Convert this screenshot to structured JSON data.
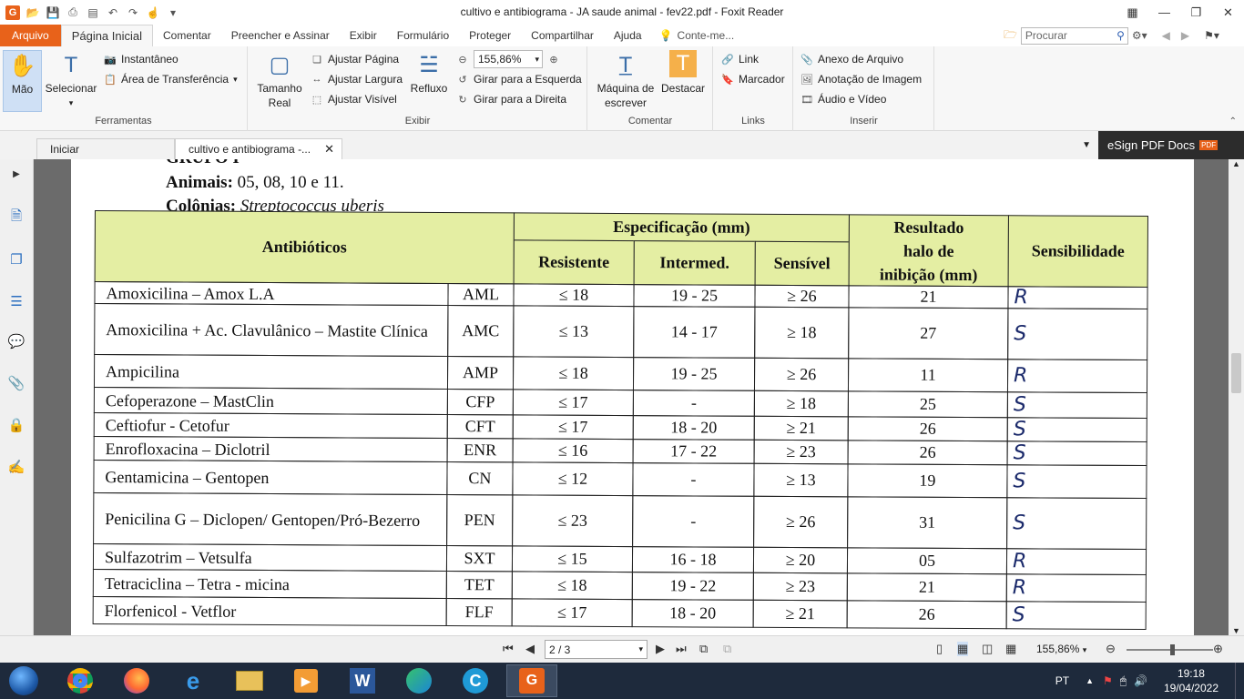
{
  "window": {
    "title": "cultivo e antibiograma - JA saude animal - fev22.pdf - Foxit Reader"
  },
  "menu": {
    "tabs": [
      "Arquivo",
      "Página Inicial",
      "Comentar",
      "Preencher e Assinar",
      "Exibir",
      "Formulário",
      "Proteger",
      "Compartilhar",
      "Ajuda"
    ],
    "tell_me": "Conte-me...",
    "search_placeholder": "Procurar"
  },
  "ribbon": {
    "ferramentas": {
      "label": "Ferramentas",
      "mao": "Mão",
      "selecionar": "Selecionar",
      "instantaneo": "Instantâneo",
      "area_transferencia": "Área de Transferência"
    },
    "exibir": {
      "label": "Exibir",
      "tamanho_real_1": "Tamanho",
      "tamanho_real_2": "Real",
      "ajustar_pagina": "Ajustar Página",
      "ajustar_largura": "Ajustar Largura",
      "ajustar_visivel": "Ajustar Visível",
      "refluxo": "Refluxo",
      "zoom": "155,86%",
      "girar_esquerda": "Girar para a Esquerda",
      "girar_direita": "Girar para a Direita"
    },
    "comentar": {
      "label": "Comentar",
      "maquina_1": "Máquina de",
      "maquina_2": "escrever",
      "destacar": "Destacar"
    },
    "links": {
      "label": "Links",
      "link": "Link",
      "marcador": "Marcador"
    },
    "inserir": {
      "label": "Inserir",
      "anexo": "Anexo de Arquivo",
      "anotacao": "Anotação de Imagem",
      "audio": "Áudio e Vídeo"
    }
  },
  "doc_tabs": [
    "Iniciar",
    "cultivo e antibiograma -..."
  ],
  "esign": "eSign PDF Docs",
  "esign_badge": "PDF",
  "document": {
    "grupo_partial": "GRUPO I",
    "animais_label": "Animais:",
    "animais_value": " 05, 08, 10 e 11.",
    "colonias_label": "Colônias:",
    "colonias_value": "Streptococcus uberis",
    "table": {
      "h_antibioticos": "Antibióticos",
      "h_especificacao": "Especificação (mm)",
      "h_resistente": "Resistente",
      "h_intermed": "Intermed.",
      "h_sensivel": "Sensível",
      "h_resultado_1": "Resultado",
      "h_resultado_2": "halo de",
      "h_resultado_3": "inibição (mm)",
      "h_sensibilidade": "Sensibilidade",
      "rows": [
        {
          "name": "Amoxicilina – Amox L.A",
          "code": "AML",
          "res": "≤ 18",
          "int": "19 - 25",
          "sen": "≥ 26",
          "halo": "21",
          "mark": "R"
        },
        {
          "name": "Amoxicilina + Ac. Clavulânico – Mastite Clínica",
          "code": "AMC",
          "res": "≤ 13",
          "int": "14 - 17",
          "sen": "≥ 18",
          "halo": "27",
          "mark": "S"
        },
        {
          "name": "Ampicilina",
          "code": "AMP",
          "res": "≤ 18",
          "int": "19 - 25",
          "sen": "≥ 26",
          "halo": "11",
          "mark": "R"
        },
        {
          "name": "Cefoperazone – MastClin",
          "code": "CFP",
          "res": "≤ 17",
          "int": "-",
          "sen": "≥ 18",
          "halo": "25",
          "mark": "S"
        },
        {
          "name": "Ceftiofur - Cetofur",
          "code": "CFT",
          "res": "≤ 17",
          "int": "18 - 20",
          "sen": "≥ 21",
          "halo": "26",
          "mark": "S"
        },
        {
          "name": "Enrofloxacina – Diclotril",
          "code": "ENR",
          "res": "≤ 16",
          "int": "17 - 22",
          "sen": "≥ 23",
          "halo": "26",
          "mark": "S"
        },
        {
          "name": "Gentamicina – Gentopen",
          "code": "CN",
          "res": "≤ 12",
          "int": "-",
          "sen": "≥ 13",
          "halo": "19",
          "mark": "S"
        },
        {
          "name": "Penicilina G – Diclopen/ Gentopen/Pró-Bezerro",
          "code": "PEN",
          "res": "≤ 23",
          "int": "-",
          "sen": "≥ 26",
          "halo": "31",
          "mark": "S"
        },
        {
          "name": "Sulfazotrim – Vetsulfa",
          "code": "SXT",
          "res": "≤ 15",
          "int": "16 - 18",
          "sen": "≥ 20",
          "halo": "05",
          "mark": "R"
        },
        {
          "name": "Tetraciclina – Tetra - micina",
          "code": "TET",
          "res": "≤ 18",
          "int": "19 - 22",
          "sen": "≥ 23",
          "halo": "21",
          "mark": "R"
        },
        {
          "name": "Florfenicol - Vetflor",
          "code": "FLF",
          "res": "≤ 17",
          "int": "18 - 20",
          "sen": "≥ 21",
          "halo": "26",
          "mark": "S"
        }
      ]
    }
  },
  "status": {
    "page": "2 / 3",
    "zoom": "155,86%"
  },
  "taskbar": {
    "lang": "PT",
    "time": "19:18",
    "date": "19/04/2022"
  }
}
